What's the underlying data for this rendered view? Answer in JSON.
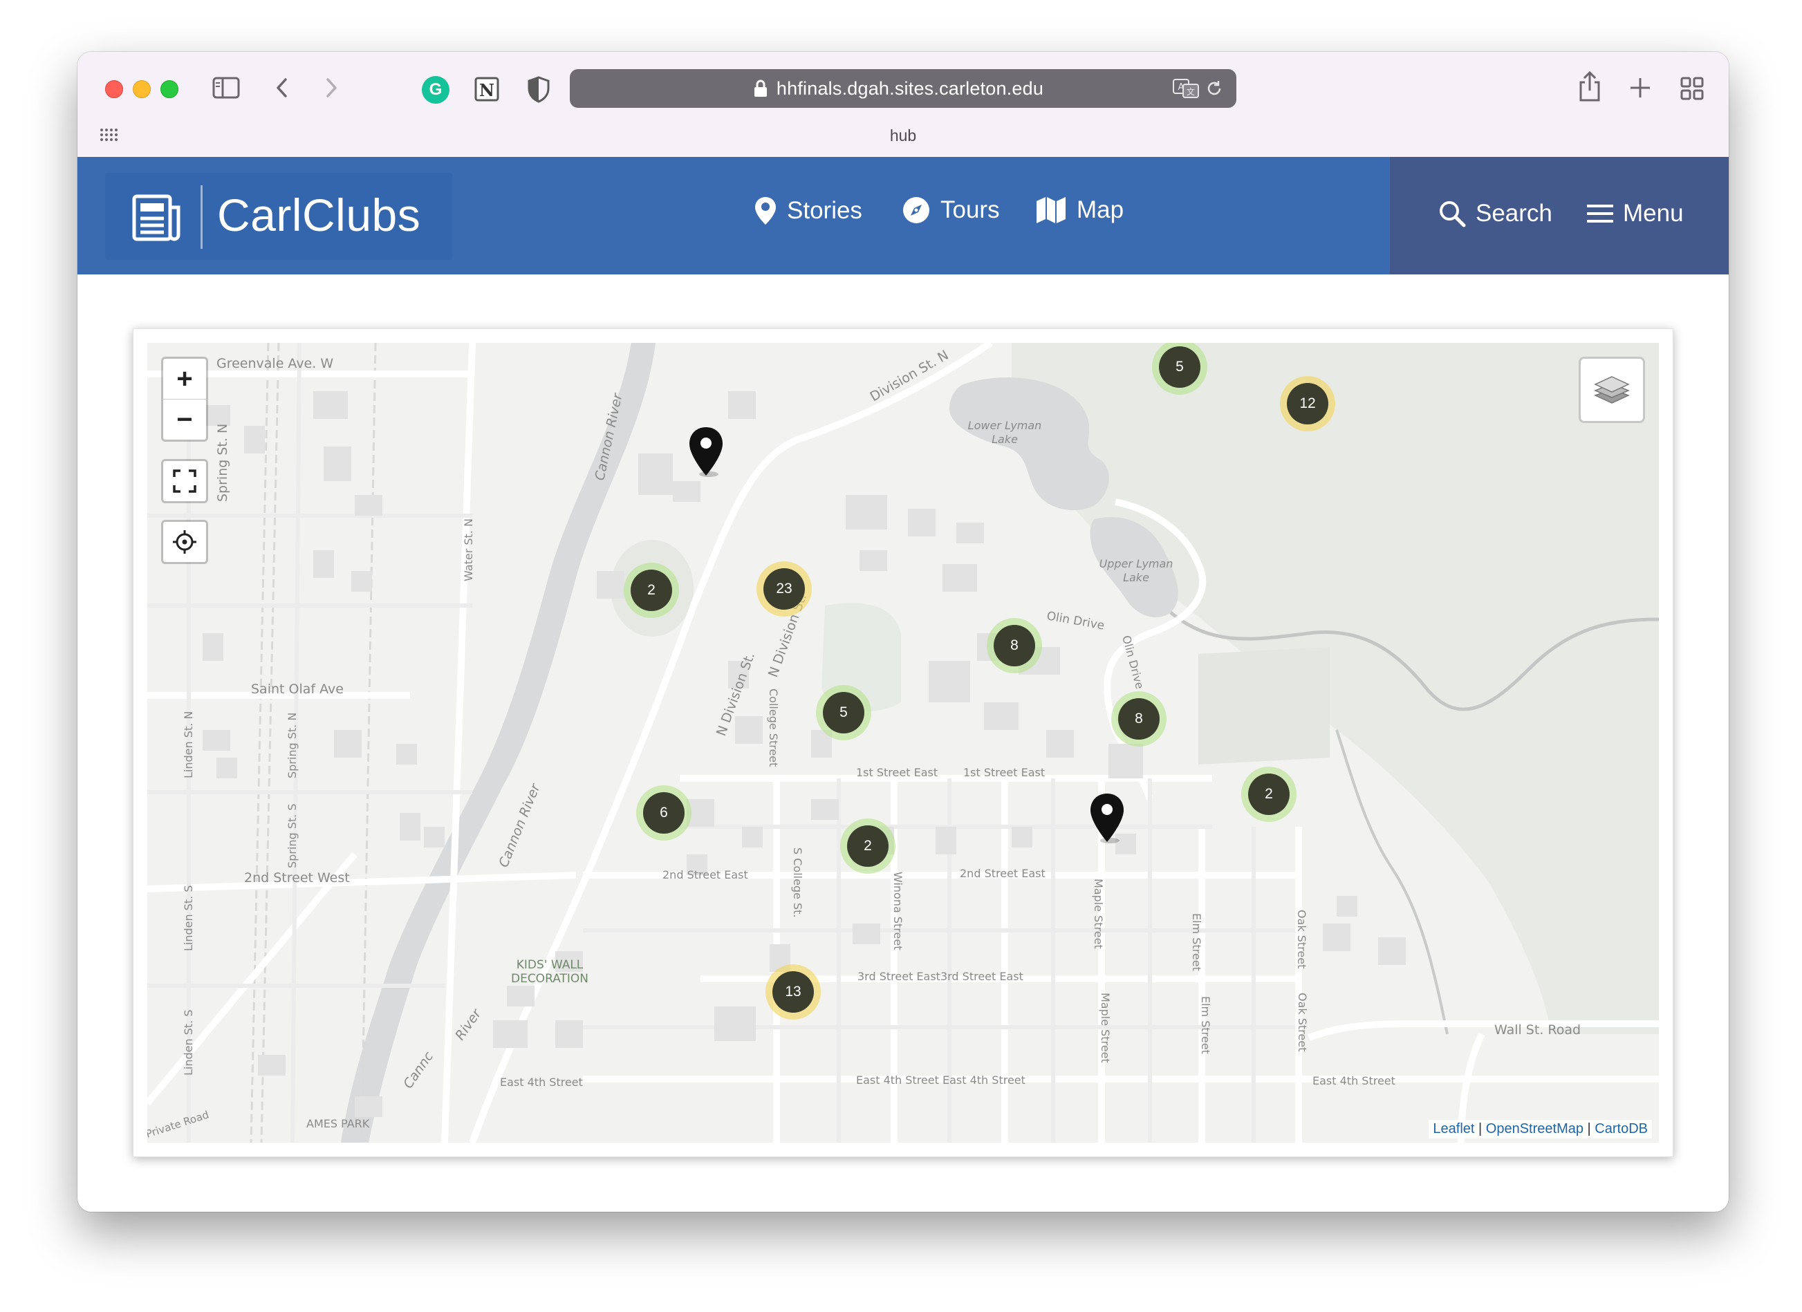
{
  "browser": {
    "url": "hhfinals.dgah.sites.carleton.edu",
    "tab_title": "hub"
  },
  "site": {
    "logo_text": "CarlClubs",
    "nav": [
      {
        "label": "Stories",
        "icon": "map-pin-icon"
      },
      {
        "label": "Tours",
        "icon": "compass-icon"
      },
      {
        "label": "Map",
        "icon": "map-icon"
      }
    ],
    "search_label": "Search",
    "menu_label": "Menu",
    "colors": {
      "header": "#3a6bb0",
      "header_right": "#43598c"
    }
  },
  "map": {
    "zoom_in": "+",
    "zoom_out": "−",
    "clusters": [
      {
        "count": "5",
        "size": "small"
      },
      {
        "count": "12",
        "size": "medium"
      },
      {
        "count": "2",
        "size": "small"
      },
      {
        "count": "23",
        "size": "medium"
      },
      {
        "count": "8",
        "size": "small"
      },
      {
        "count": "5",
        "size": "small"
      },
      {
        "count": "8",
        "size": "small"
      },
      {
        "count": "6",
        "size": "small"
      },
      {
        "count": "2",
        "size": "small"
      },
      {
        "count": "2",
        "size": "small"
      },
      {
        "count": "13",
        "size": "medium"
      }
    ],
    "labels": {
      "greenvale": "Greenvale Ave. W",
      "division_top": "Division St. N",
      "cannon_river_1": "Cannon River",
      "cannon_river_2": "Cannon River",
      "cannon_river_3": "Cannc",
      "cannon_river_4": "River",
      "lower_lyman": "Lower Lyman",
      "lake_1": "Lake",
      "upper_lyman": "Upper Lyman",
      "lake_2": "Lake",
      "spring_n": "Spring St. N",
      "water_n": "Water St. N",
      "n_division_1": "N Division St.",
      "n_division_2": "N Division St.",
      "college_street": "College Street",
      "olin_drive": "Olin Drive",
      "olin_drive_2": "Olin Drive",
      "saint_olaf": "Saint Olaf Ave",
      "linden_n": "Linden St. N",
      "spring_n2": "Spring St. N",
      "spring_s": "Spring St. S",
      "first_east_1": "1st Street East",
      "first_east_2": "1st Street East",
      "second_west": "2nd Street West",
      "second_east_1": "2nd Street East",
      "second_east_2": "2nd Street East",
      "s_college": "S College St.",
      "winona": "Winona Street",
      "maple_1": "Maple Street",
      "maple_2": "Maple Street",
      "elm_1": "Elm Street",
      "elm_2": "Elm Street",
      "oak_1": "Oak Street",
      "oak_2": "Oak Street",
      "linden_s": "Linden St. S",
      "linden_s2": "Linden St. S",
      "kids_wall_1": "KIDS' WALL",
      "kids_wall_2": "DECORATION",
      "third_east": "3rd Street East3rd Street East",
      "wall_st": "Wall St. Road",
      "fourth_east_1": "East 4th Street",
      "fourth_east_2": "East 4th Street  East 4th Street",
      "fourth_east_3": "East 4th Street",
      "private_road": "Private Road",
      "ames_park": "AMES PARK"
    },
    "attribution": [
      "Leaflet",
      "OpenStreetMap",
      "CartoDB"
    ]
  }
}
